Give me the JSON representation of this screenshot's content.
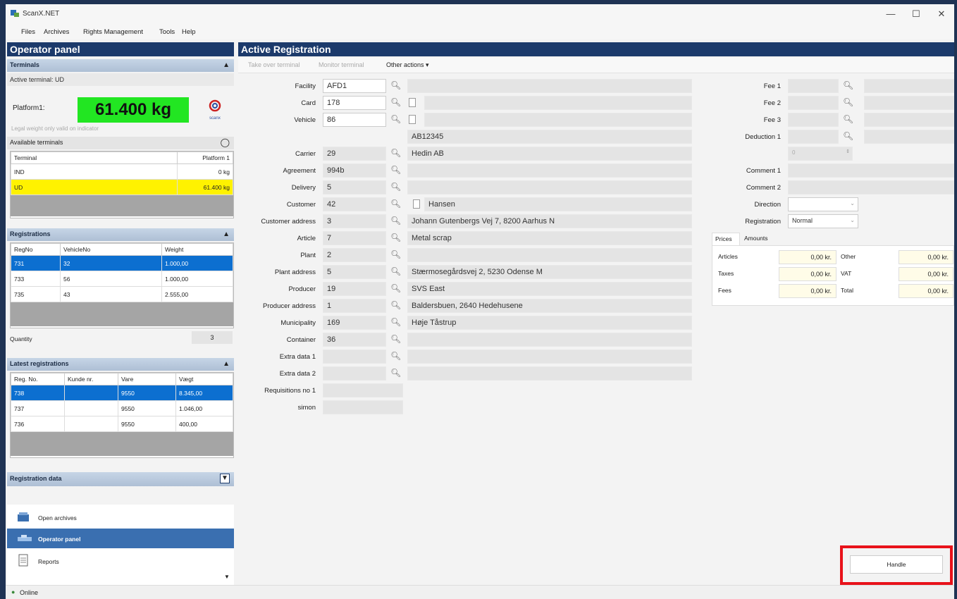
{
  "window": {
    "title": "ScanX.NET",
    "min": "—",
    "max": "☐",
    "close": "✕"
  },
  "menu": [
    "Files",
    "Archives",
    "Rights Management",
    "Tools",
    "Help"
  ],
  "left": {
    "title": "Operator panel",
    "terminals": {
      "header": "Terminals",
      "active_terminal": "Active terminal: UD",
      "platform_label": "Platform1:",
      "weight": "61.400 kg",
      "logo_text": "scanx",
      "legal_note": "Legal weight only valid on indicator",
      "available_header": "Available terminals",
      "columns": [
        "Terminal",
        "Platform 1"
      ],
      "rows": [
        {
          "terminal": "IND",
          "platform": "0 kg"
        },
        {
          "terminal": "UD",
          "platform": "61.400 kg"
        }
      ]
    },
    "registrations": {
      "header": "Registrations",
      "columns": [
        "RegNo",
        "VehicleNo",
        "Weight"
      ],
      "rows": [
        {
          "regno": "731",
          "vehicle": "32",
          "weight": "1.000,00"
        },
        {
          "regno": "733",
          "vehicle": "56",
          "weight": "1.000,00"
        },
        {
          "regno": "735",
          "vehicle": "43",
          "weight": "2.555,00"
        }
      ],
      "quantity_label": "Quantity",
      "quantity_value": "3"
    },
    "latest": {
      "header": "Latest registrations",
      "columns": [
        "Reg. No.",
        "Kunde nr.",
        "Vare",
        "Vægt"
      ],
      "rows": [
        {
          "regno": "738",
          "kunde": "",
          "vare": "9550",
          "vaegt": "8.345,00"
        },
        {
          "regno": "737",
          "kunde": "",
          "vare": "9550",
          "vaegt": "1.046,00"
        },
        {
          "regno": "736",
          "kunde": "",
          "vare": "9550",
          "vaegt": "400,00"
        }
      ]
    },
    "registration_data": "Registration data",
    "nav": [
      {
        "label": "Open archives",
        "icon": "archive-icon"
      },
      {
        "label": "Operator panel",
        "icon": "scale-icon"
      },
      {
        "label": "Reports",
        "icon": "report-icon"
      }
    ]
  },
  "main": {
    "title": "Active Registration",
    "toolbar": [
      "Take over terminal",
      "Monitor terminal",
      "Other actions ▾"
    ],
    "fields": [
      {
        "label": "Facility",
        "value": "AFD1",
        "text": ""
      },
      {
        "label": "Card",
        "value": "178",
        "text": ""
      },
      {
        "label": "Vehicle",
        "value": "86",
        "text": ""
      },
      {
        "label": "",
        "value": "",
        "text": "AB12345"
      },
      {
        "label": "Carrier",
        "value": "29",
        "text": "Hedin AB"
      },
      {
        "label": "Agreement",
        "value": "994b",
        "text": ""
      },
      {
        "label": "Delivery",
        "value": "5",
        "text": ""
      },
      {
        "label": "Customer",
        "value": "42",
        "text": "Hansen"
      },
      {
        "label": "Customer address",
        "value": "3",
        "text": "Johann Gutenbergs Vej 7, 8200 Aarhus N"
      },
      {
        "label": "Article",
        "value": "7",
        "text": "Metal scrap"
      },
      {
        "label": "Plant",
        "value": "2",
        "text": ""
      },
      {
        "label": "Plant address",
        "value": "5",
        "text": "Stærmosegårdsvej 2, 5230 Odense M"
      },
      {
        "label": "Producer",
        "value": "19",
        "text": "SVS East"
      },
      {
        "label": "Producer address",
        "value": "1",
        "text": "Baldersbuen, 2640 Hedehusene"
      },
      {
        "label": "Municipality",
        "value": "169",
        "text": "Høje Tåstrup"
      },
      {
        "label": "Container",
        "value": "36",
        "text": ""
      },
      {
        "label": "Extra data 1",
        "value": "",
        "text": ""
      },
      {
        "label": "Extra data 2",
        "value": "",
        "text": ""
      },
      {
        "label": "Requisitions no 1",
        "value": "",
        "text": ""
      },
      {
        "label": "simon",
        "value": "",
        "text": ""
      }
    ],
    "fees": [
      {
        "label": "Fee 1"
      },
      {
        "label": "Fee 2"
      },
      {
        "label": "Fee 3"
      },
      {
        "label": "Deduction 1"
      }
    ],
    "deduction_value": "0",
    "comment1": "Comment 1",
    "comment2": "Comment 2",
    "direction_label": "Direction",
    "registration_label": "Registration",
    "registration_value": "Normal",
    "tabs": [
      "Prices",
      "Amounts"
    ],
    "prices": [
      {
        "label": "Articles",
        "value": "0,00 kr.",
        "label2": "Other",
        "value2": "0,00 kr."
      },
      {
        "label": "Taxes",
        "value": "0,00 kr.",
        "label2": "VAT",
        "value2": "0,00 kr."
      },
      {
        "label": "Fees",
        "value": "0,00 kr.",
        "label2": "Total",
        "value2": "0,00 kr."
      }
    ],
    "handle_label": "Handle"
  },
  "status": {
    "online": "Online"
  },
  "colors": {
    "navy": "#1c3a6b",
    "weight_green": "#22e622",
    "selected": "#0c6fd0",
    "highlight": "#fff200",
    "handle_border": "#e8121a"
  }
}
